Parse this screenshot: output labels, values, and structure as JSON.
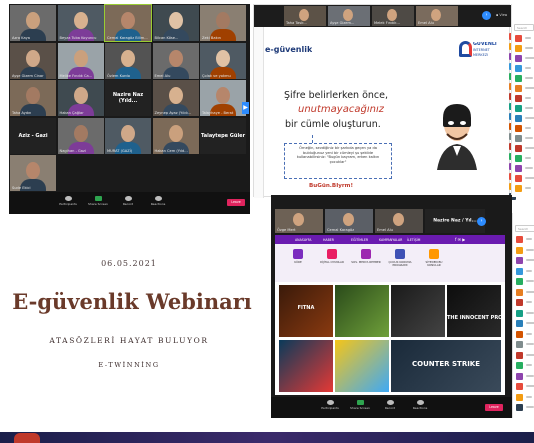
{
  "date": "06.05.2021",
  "title": "E-güvenlik Webinarı",
  "subtitle": "ATASÖZLERİ HAYAT BULUYOR",
  "subtitle2": "E-TWİNNİNG",
  "zoom1": {
    "tiles": [
      "Azra Kaya",
      "Beyza Tuba Koyuncu",
      "Cemal Karagöz Bilim...",
      "Bilcan Köse...",
      "Zeki Bakın",
      "Ayşe Gizem Cinar",
      "Melike Fındık Ca...",
      "Özlem Kurdo",
      "Emel Alu",
      "Çolak ve yokmu",
      "Taha Aydın",
      "Hakan Çağlar",
      "Nazire Naz (Yıld...",
      "Zeynep Ayaz (Yıldı...",
      "Talayhaye - Berat",
      "Aziz - Gazi",
      "Nagihan - Gazi",
      "MURAT (GAZİ)",
      "Hakan Cem (Yıld...",
      "Talaytepe Güler",
      "Sude Ekici"
    ],
    "toolbar": [
      "Participants",
      "Share Screen",
      "Record",
      "Reactions"
    ],
    "leave": "Leave"
  },
  "slide": {
    "header": "e-güvenlik",
    "logo": [
      "GÜVENLİ",
      "İNTERNET",
      "MERKEZİ"
    ],
    "line1": "Şifre belirlerken önce,",
    "line2": "unutmayacağınız",
    "line3": "bir cümle oluşturun.",
    "example": "Örneğin, sevdiğiniz bir şarkıda geçen ya da bulduğunuz yeni bir cümleyi şu şekilde kullanabilirsiniz: \"Bugün bayram, erken kalkın çocuklar\"",
    "password": "BuGün.Bİyrm!",
    "top_tiles": [
      "Taha Tasir...",
      "Ayşe Gizem...",
      "Melek Fındık...",
      "Emel Alu"
    ],
    "search": "Search"
  },
  "zoom3": {
    "top_tiles": [
      "Özge Mert",
      "Cemal Karagöz",
      "Emel Alu",
      "Nazire Naz / Yıl..."
    ],
    "nav": [
      "ANASAYFA",
      "HABER",
      "EĞİTİMLER",
      "KAMPANYALAR",
      "İLETİŞİM"
    ],
    "icons": [
      "KÜRE",
      "DİJİTAL OYUNLAR",
      "SOS. MEDYA REHBER",
      "ÇOCUK KORUMA PROGRAMI",
      "SİTEDEN BU KONULAR"
    ],
    "games": [
      "FITNA",
      "",
      "",
      "THE INNOCENT PROPHET",
      "",
      "",
      "COUNTER STRIKE"
    ],
    "toolbar": [
      "Participants",
      "Share Screen",
      "Record",
      "Reactions"
    ],
    "leave": "Leave",
    "search": "Search"
  },
  "colors": {
    "leave": "#e0245e",
    "share": "#2ea44f",
    "accent": "#7b2cbf"
  }
}
